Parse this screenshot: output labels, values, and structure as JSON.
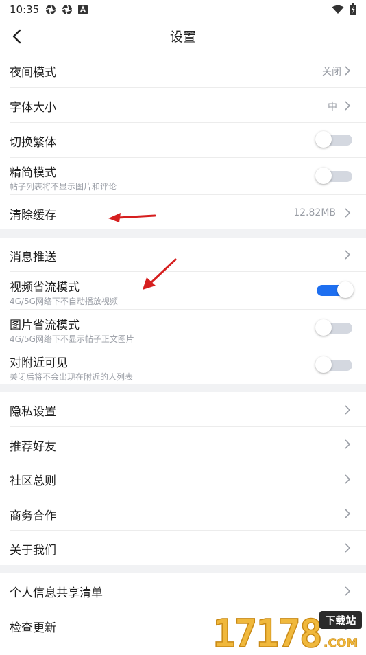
{
  "status_bar": {
    "time": "10:35"
  },
  "nav": {
    "title": "设置"
  },
  "section1": {
    "night_mode": {
      "label": "夜间模式",
      "value": "关闭"
    },
    "font_size": {
      "label": "字体大小",
      "value": "中"
    },
    "traditional": {
      "label": "切换繁体",
      "on": false
    },
    "simple_mode": {
      "label": "精简模式",
      "sub": "帖子列表将不显示图片和评论",
      "on": false
    },
    "clear_cache": {
      "label": "清除缓存",
      "value": "12.82MB"
    }
  },
  "section2": {
    "push": {
      "label": "消息推送"
    },
    "video_saver": {
      "label": "视频省流模式",
      "sub": "4G/5G网络下不自动播放视频",
      "on": true
    },
    "image_saver": {
      "label": "图片省流模式",
      "sub": "4G/5G网络下不显示帖子正文图片",
      "on": false
    },
    "nearby": {
      "label": "对附近可见",
      "sub": "关闭后将不会出现在附近的人列表",
      "on": false
    }
  },
  "section3": {
    "privacy": {
      "label": "隐私设置"
    },
    "recommend": {
      "label": "推荐好友"
    },
    "rules": {
      "label": "社区总则"
    },
    "business": {
      "label": "商务合作"
    },
    "about": {
      "label": "关于我们"
    }
  },
  "section4": {
    "info_share": {
      "label": "个人信息共享清单"
    },
    "update": {
      "label": "检查更新"
    }
  },
  "watermark": {
    "badge": "下载站",
    "number": "17178",
    "domain": ".COM"
  },
  "colors": {
    "accent": "#1e6ff0",
    "arrow": "#d61f1f",
    "watermark": "#f0b83c"
  }
}
